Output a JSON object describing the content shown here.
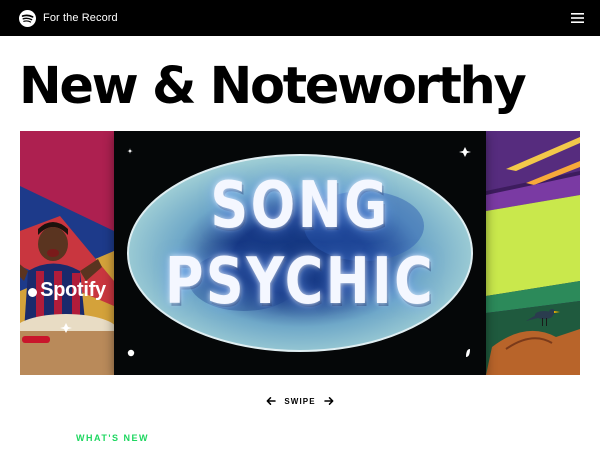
{
  "header": {
    "brand_name": "For the Record",
    "logo_icon": "spotify-logo-icon",
    "menu_icon": "hamburger-menu-icon"
  },
  "page": {
    "title": "New & Noteworthy"
  },
  "carousel": {
    "cards": [
      {
        "art_text": "Spotify"
      },
      {
        "title_line1": "SONG",
        "title_line2": "PSYCHIC"
      },
      {
        "art_text": ""
      }
    ],
    "swipe_label": "SWIPE",
    "prev_icon": "arrow-left-icon",
    "next_icon": "arrow-right-icon"
  },
  "section": {
    "whats_new": "WHAT'S NEW"
  },
  "colors": {
    "header_bg": "#000000",
    "accent_green": "#1ed760",
    "background": "#ffffff"
  }
}
